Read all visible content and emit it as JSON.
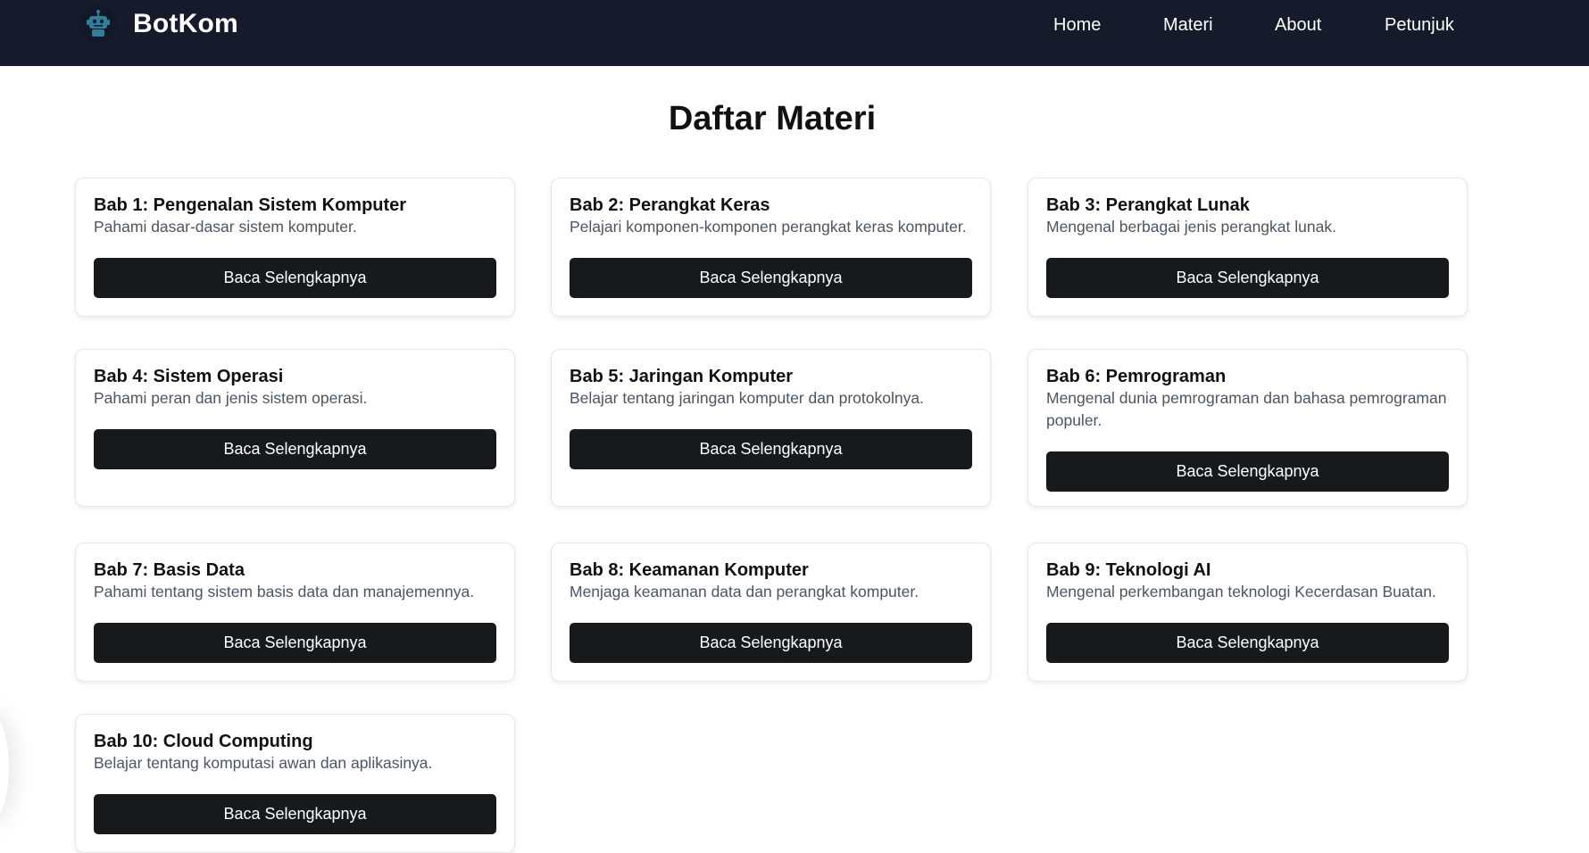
{
  "navbar": {
    "brand": "BotKom",
    "logo_icon": "robot-icon",
    "links": [
      {
        "label": "Home"
      },
      {
        "label": "Materi"
      },
      {
        "label": "About"
      },
      {
        "label": "Petunjuk"
      }
    ]
  },
  "main": {
    "title": "Daftar Materi",
    "cards": [
      {
        "title": "Bab 1: Pengenalan Sistem Komputer",
        "desc": "Pahami dasar-dasar sistem komputer.",
        "button": "Baca Selengkapnya"
      },
      {
        "title": "Bab 2: Perangkat Keras",
        "desc": "Pelajari komponen-komponen perangkat keras komputer.",
        "button": "Baca Selengkapnya"
      },
      {
        "title": "Bab 3: Perangkat Lunak",
        "desc": "Mengenal berbagai jenis perangkat lunak.",
        "button": "Baca Selengkapnya"
      },
      {
        "title": "Bab 4: Sistem Operasi",
        "desc": "Pahami peran dan jenis sistem operasi.",
        "button": "Baca Selengkapnya"
      },
      {
        "title": "Bab 5: Jaringan Komputer",
        "desc": "Belajar tentang jaringan komputer dan protokolnya.",
        "button": "Baca Selengkapnya"
      },
      {
        "title": "Bab 6: Pemrograman",
        "desc": "Mengenal dunia pemrograman dan bahasa pemrograman populer.",
        "button": "Baca Selengkapnya"
      },
      {
        "title": "Bab 7: Basis Data",
        "desc": "Pahami tentang sistem basis data dan manajemennya.",
        "button": "Baca Selengkapnya"
      },
      {
        "title": "Bab 8: Keamanan Komputer",
        "desc": "Menjaga keamanan data dan perangkat komputer.",
        "button": "Baca Selengkapnya"
      },
      {
        "title": "Bab 9: Teknologi AI",
        "desc": "Mengenal perkembangan teknologi Kecerdasan Buatan.",
        "button": "Baca Selengkapnya"
      },
      {
        "title": "Bab 10: Cloud Computing",
        "desc": "Belajar tentang komputasi awan dan aplikasinya.",
        "button": "Baca Selengkapnya"
      }
    ]
  },
  "colors": {
    "navbar_bg": "#151b2b",
    "button_bg": "#18191d",
    "logo_accent": "#2f7f9a"
  }
}
